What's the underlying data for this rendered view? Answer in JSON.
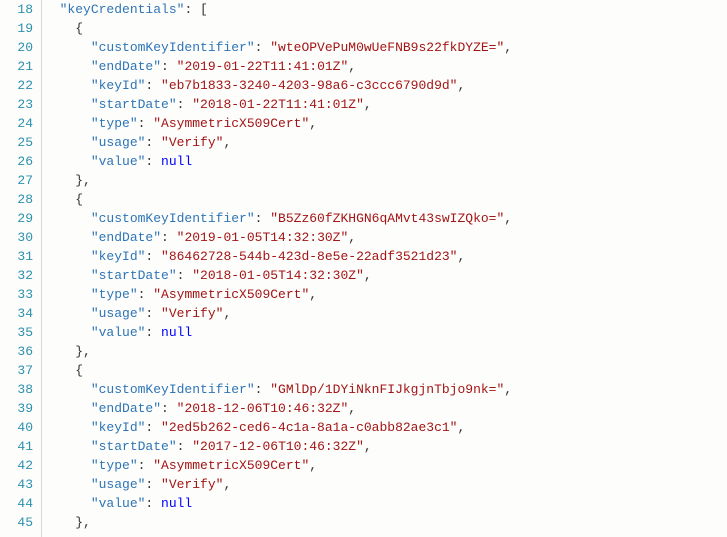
{
  "startLine": 18,
  "keys": {
    "keyCredentials": "keyCredentials",
    "customKeyIdentifier": "customKeyIdentifier",
    "endDate": "endDate",
    "keyId": "keyId",
    "startDate": "startDate",
    "type": "type",
    "usage": "usage",
    "value": "value"
  },
  "literals": {
    "null": "null"
  },
  "entries": [
    {
      "customKeyIdentifier": "wteOPVePuM0wUeFNB9s22fkDYZE=",
      "endDate": "2019-01-22T11:41:01Z",
      "keyId": "eb7b1833-3240-4203-98a6-c3ccc6790d9d",
      "startDate": "2018-01-22T11:41:01Z",
      "type": "AsymmetricX509Cert",
      "usage": "Verify",
      "value": null
    },
    {
      "customKeyIdentifier": "B5Zz60fZKHGN6qAMvt43swIZQko=",
      "endDate": "2019-01-05T14:32:30Z",
      "keyId": "86462728-544b-423d-8e5e-22adf3521d23",
      "startDate": "2018-01-05T14:32:30Z",
      "type": "AsymmetricX509Cert",
      "usage": "Verify",
      "value": null
    },
    {
      "customKeyIdentifier": "GMlDp/1DYiNknFIJkgjnTbjo9nk=",
      "endDate": "2018-12-06T10:46:32Z",
      "keyId": "2ed5b262-ced6-4c1a-8a1a-c0abb82ae3c1",
      "startDate": "2017-12-06T10:46:32Z",
      "type": "AsymmetricX509Cert",
      "usage": "Verify",
      "value": null
    }
  ]
}
